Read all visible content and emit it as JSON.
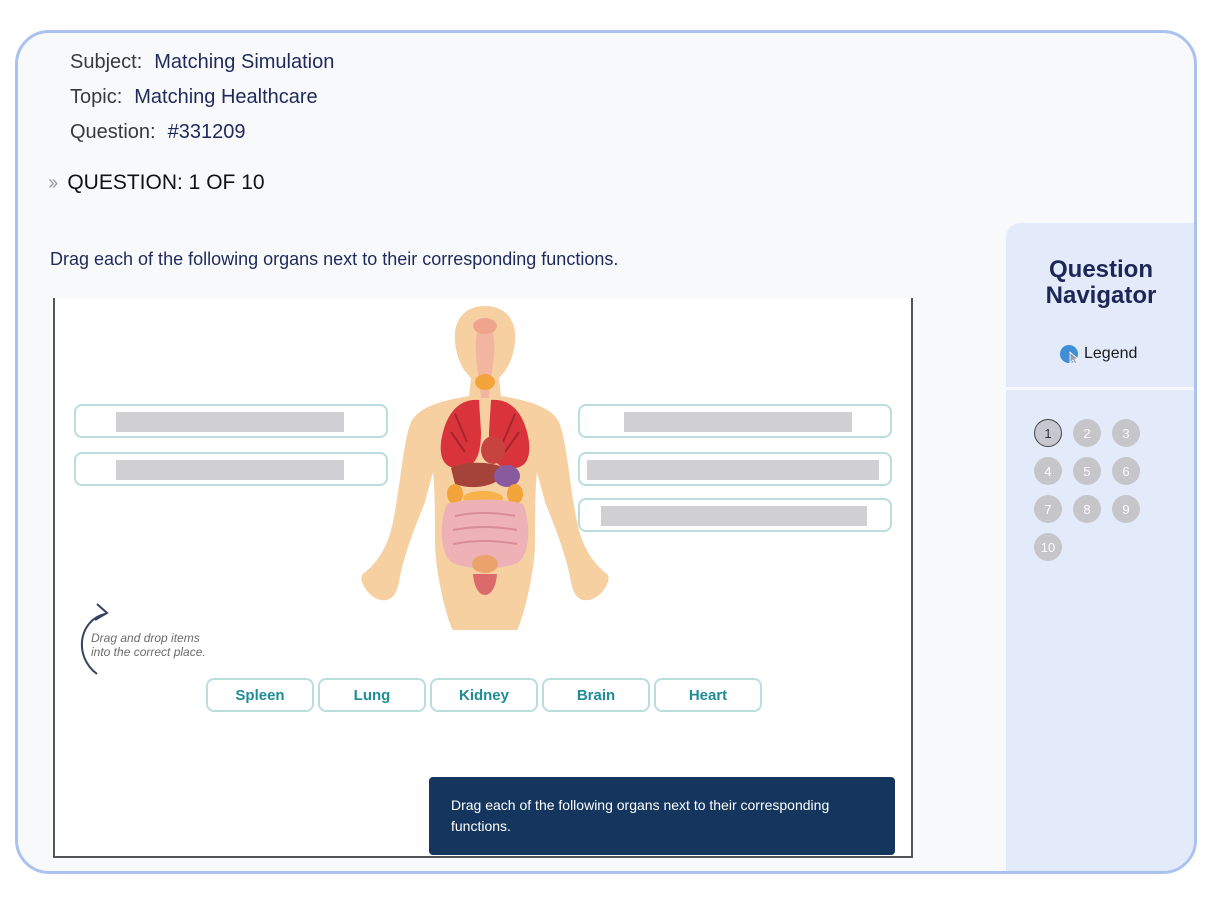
{
  "meta": {
    "subject_label": "Subject:",
    "subject_value": "Matching Simulation",
    "topic_label": "Topic:",
    "topic_value": "Matching Healthcare",
    "question_label": "Question:",
    "question_value": "#331209"
  },
  "question_counter": {
    "prefix": "QUESTION",
    "value": ": 1 OF 10"
  },
  "instruction": "Drag each of the following organs next to their corresponding functions.",
  "simulation": {
    "hint": [
      "Drag and drop items",
      "into the correct place."
    ],
    "options": [
      "Spleen",
      "Lung",
      "Kidney",
      "Brain",
      "Heart"
    ],
    "tooltip": "Drag each of the following organs next to their corresponding functions."
  },
  "navigator": {
    "title_line1": "Question",
    "title_line2": "Navigator",
    "legend": "Legend",
    "questions": [
      "1",
      "2",
      "3",
      "4",
      "5",
      "6",
      "7",
      "8",
      "9",
      "10"
    ],
    "current": "1"
  },
  "colors": {
    "frame_border": "#a9c3ee",
    "navy_text": "#1f2a5c",
    "chip_text": "#1f8c96",
    "tooltip_bg": "#14365e",
    "nav_bg": "#e3ebfb"
  }
}
